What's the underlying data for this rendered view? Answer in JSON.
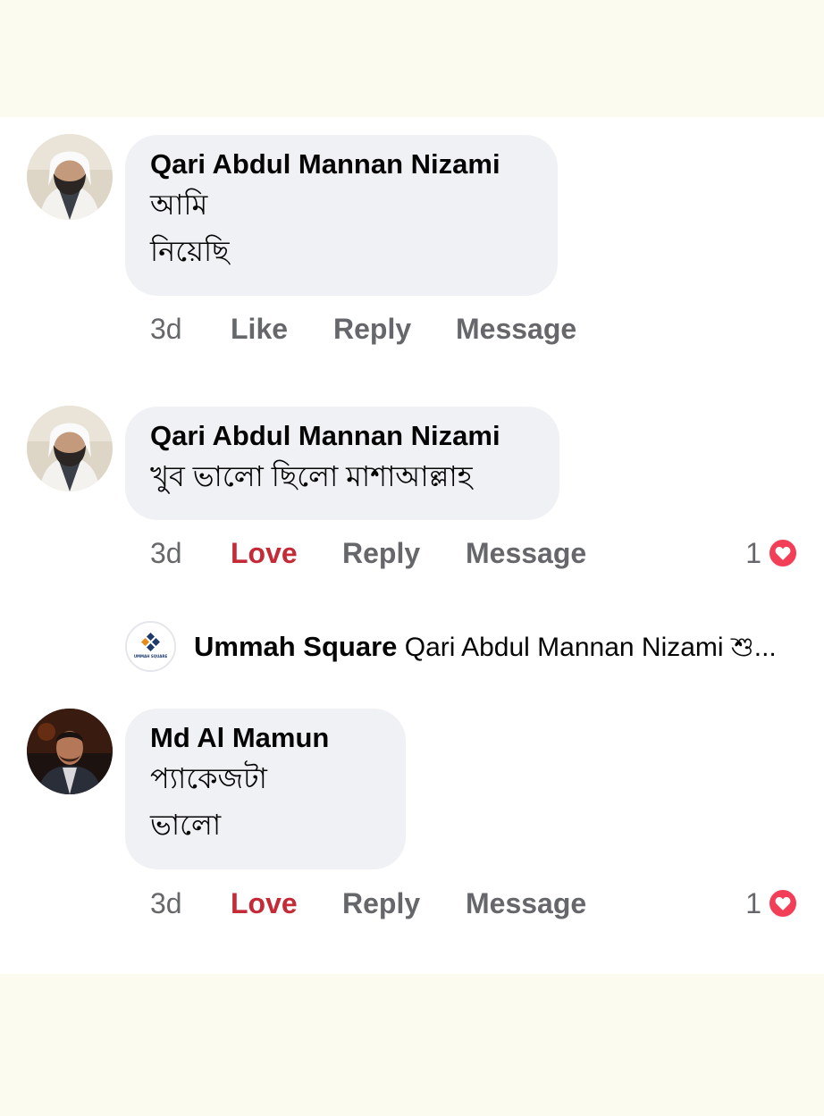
{
  "comments": [
    {
      "author": "Qari Abdul Mannan Nizami",
      "lines": [
        "আমি",
        "নিয়েছি"
      ],
      "time": "3d",
      "reaction_label": "Like",
      "reply_label": "Reply",
      "message_label": "Message"
    },
    {
      "author": "Qari Abdul Mannan Nizami",
      "lines": [
        "খুব ভালো ছিলো মাশাআল্লাহ"
      ],
      "time": "3d",
      "reaction_label": "Love",
      "reply_label": "Reply",
      "message_label": "Message",
      "reaction_count": "1",
      "reaction_icon": "heart-icon"
    },
    {
      "author": "Md Al Mamun",
      "lines": [
        "প্যাকেজটা",
        "ভালো"
      ],
      "time": "3d",
      "reaction_label": "Love",
      "reply_label": "Reply",
      "message_label": "Message",
      "reaction_count": "1",
      "reaction_icon": "heart-icon"
    }
  ],
  "page_reply": {
    "page_name": "Ummah Square",
    "snippet": "Qari Abdul Mannan Nizami শু...",
    "logo_text": "UMMAH SQUARE"
  },
  "colors": {
    "bubble": "#f0f1f5",
    "love": "#c52a37",
    "meta": "#65676b",
    "heart_badge": "#f33e58",
    "band": "#fbfbf0"
  }
}
